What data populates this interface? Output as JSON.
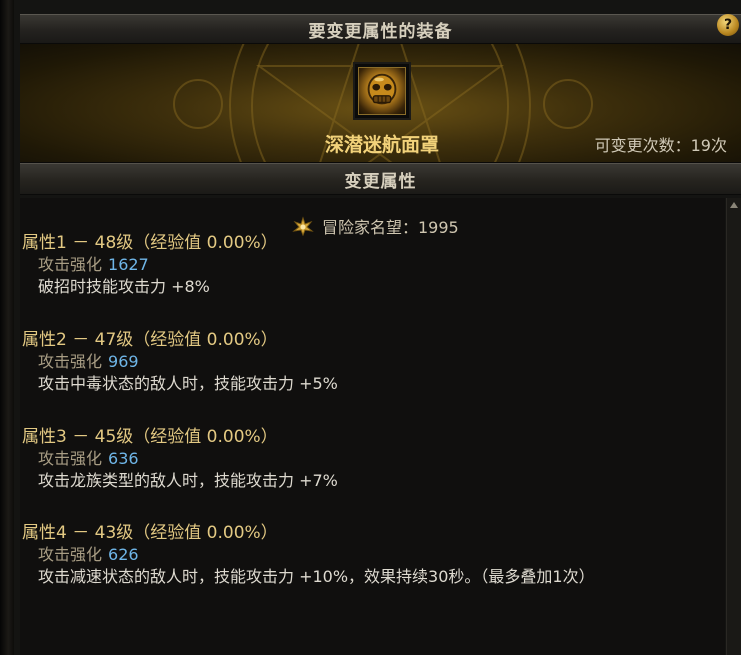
{
  "header": {
    "title": "要变更属性的装备",
    "help": "?"
  },
  "item": {
    "name": "深潜迷航面罩",
    "change_count": "可变更次数：19次",
    "icon": "mask-icon"
  },
  "section": {
    "title": "变更属性"
  },
  "reputation": {
    "icon": "adventurer-reputation-icon",
    "text": "冒险家名望：1995"
  },
  "attributes": [
    {
      "title": "属性1 － 48级（经验值 0.00%）",
      "stat_label": "攻击强化",
      "stat_value": "1627",
      "effect": "破招时技能攻击力 +8%"
    },
    {
      "title": "属性2 － 47级（经验值 0.00%）",
      "stat_label": "攻击强化",
      "stat_value": "969",
      "effect": "攻击中毒状态的敌人时，技能攻击力 +5%"
    },
    {
      "title": "属性3 － 45级（经验值 0.00%）",
      "stat_label": "攻击强化",
      "stat_value": "636",
      "effect": "攻击龙族类型的敌人时，技能攻击力 +7%"
    },
    {
      "title": "属性4 － 43级（经验值 0.00%）",
      "stat_label": "攻击强化",
      "stat_value": "626",
      "effect": "攻击减速状态的敌人时，技能攻击力 +10%，效果持续30秒。（最多叠加1次）"
    }
  ],
  "colors": {
    "gold_text": "#f2d27a",
    "attr_title": "#e3c983",
    "stat_value": "#6fb6e8",
    "panel_bg": "#141412"
  }
}
